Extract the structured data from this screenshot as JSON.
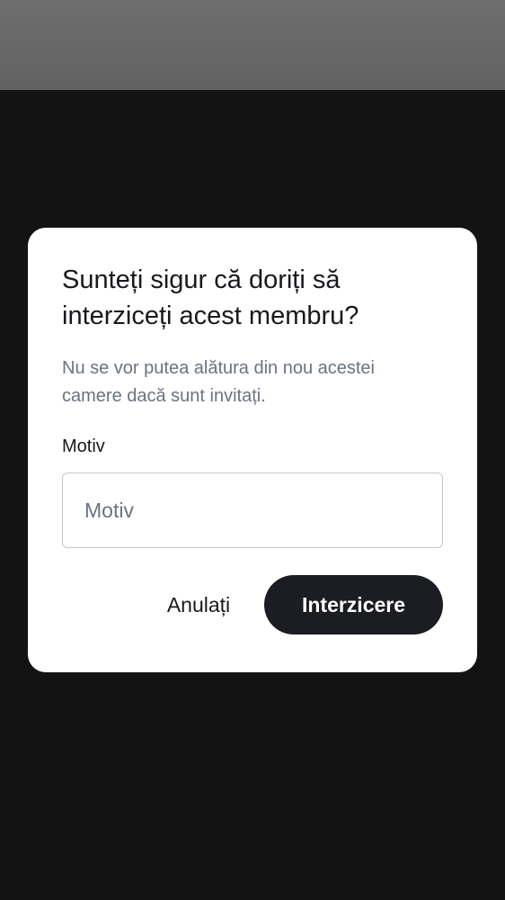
{
  "dialog": {
    "title": "Sunteți sigur că doriți să interziceți acest membru?",
    "description": "Nu se vor putea alătura din nou acestei camere dacă sunt invitați.",
    "reason_label": "Motiv",
    "reason_placeholder": "Motiv",
    "reason_value": "",
    "cancel_label": "Anulați",
    "confirm_label": "Interzicere"
  },
  "colors": {
    "primary_button": "#1b1d22",
    "backdrop": "#131313",
    "status_bar": "#6e6e6e",
    "muted_text": "#6b7280"
  }
}
